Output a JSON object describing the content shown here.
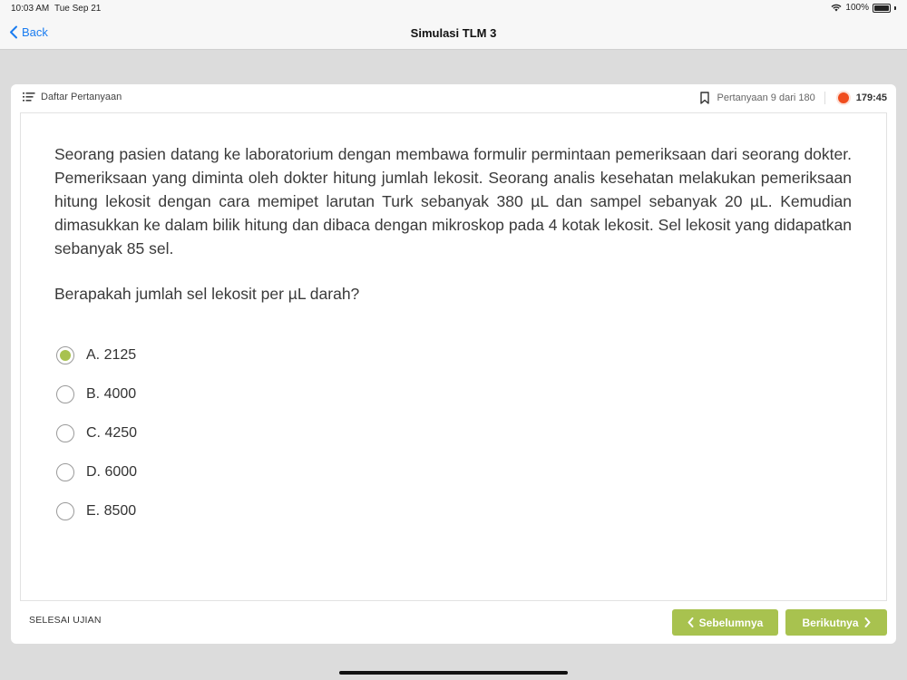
{
  "status_bar": {
    "time": "10:03 AM",
    "date": "Tue Sep 21",
    "battery": "100%"
  },
  "nav": {
    "back_label": "Back",
    "title": "Simulasi TLM 3"
  },
  "header": {
    "question_list_label": "Daftar Pertanyaan",
    "progress_label": "Pertanyaan 9 dari 180",
    "timer": "179:45"
  },
  "question": {
    "text": "Seorang pasien datang ke laboratorium dengan membawa formulir permintaan pemeriksaan dari seorang dokter. Pemeriksaan yang diminta oleh dokter hitung jumlah lekosit. Seorang analis kesehatan melakukan pemeriksaan hitung lekosit dengan cara memipet larutan Turk sebanyak 380 µL dan sampel sebanyak 20 µL. Kemudian dimasukkan ke dalam bilik hitung dan dibaca dengan mikroskop pada 4 kotak lekosit. Sel lekosit yang didapatkan sebanyak 85 sel.",
    "prompt": "Berapakah jumlah sel lekosit per µL darah?",
    "options": [
      {
        "label": "A. 2125",
        "selected": true
      },
      {
        "label": "B. 4000",
        "selected": false
      },
      {
        "label": "C. 4250",
        "selected": false
      },
      {
        "label": "D. 6000",
        "selected": false
      },
      {
        "label": "E. 8500",
        "selected": false
      }
    ]
  },
  "footer": {
    "finish_label": "SELESAI UJIAN",
    "prev_label": "Sebelumnya",
    "next_label": "Berikutnya"
  },
  "colors": {
    "accent": "#a8c24f",
    "link": "#1a7cf0",
    "timer": "#f04d1e"
  },
  "icons": {
    "back": "chevron-left-icon",
    "list": "list-icon",
    "bookmark": "bookmark-icon",
    "timer": "record-dot-icon",
    "prev": "chevron-left-icon",
    "next": "chevron-right-icon"
  }
}
